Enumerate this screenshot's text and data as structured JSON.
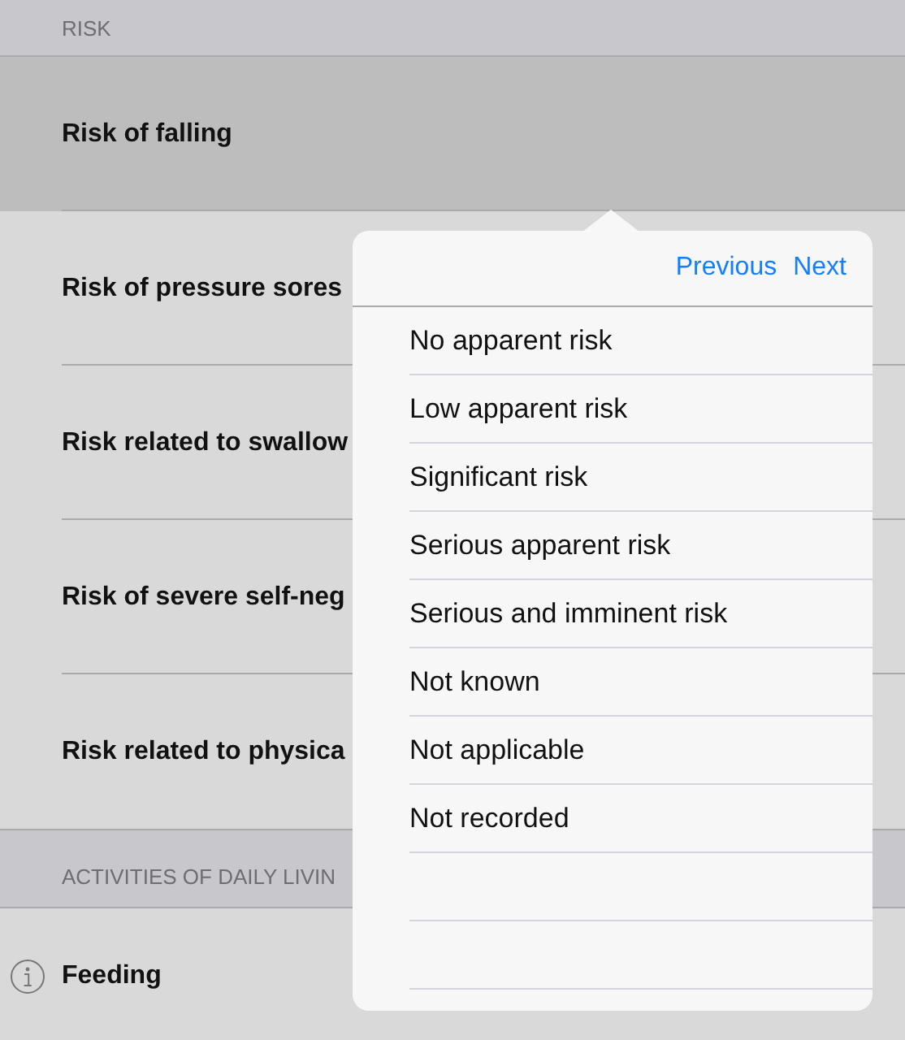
{
  "sections": [
    {
      "header": "RISK",
      "rows": [
        {
          "label": "Risk of falling",
          "selected": true,
          "info": false
        },
        {
          "label": "Risk of pressure sores",
          "selected": false,
          "info": false
        },
        {
          "label": "Risk related to swallow",
          "selected": false,
          "info": false
        },
        {
          "label": "Risk of severe self-neg",
          "selected": false,
          "info": false
        },
        {
          "label": "Risk related to physica",
          "selected": false,
          "info": false
        }
      ]
    },
    {
      "header": "ACTIVITIES OF DAILY LIVIN",
      "rows": [
        {
          "label": "Feeding",
          "selected": false,
          "info": true
        }
      ]
    }
  ],
  "popover": {
    "nav": [
      "Previous",
      "Next"
    ],
    "options": [
      {
        "label": "No apparent risk",
        "selected": false
      },
      {
        "label": "Low apparent risk",
        "selected": false
      },
      {
        "label": "Significant risk",
        "selected": false
      },
      {
        "label": "Serious apparent risk",
        "selected": false
      },
      {
        "label": "Serious and imminent risk",
        "selected": false
      },
      {
        "label": "Not known",
        "selected": false
      },
      {
        "label": "Not applicable",
        "selected": false
      },
      {
        "label": "Not recorded",
        "selected": false
      }
    ]
  }
}
